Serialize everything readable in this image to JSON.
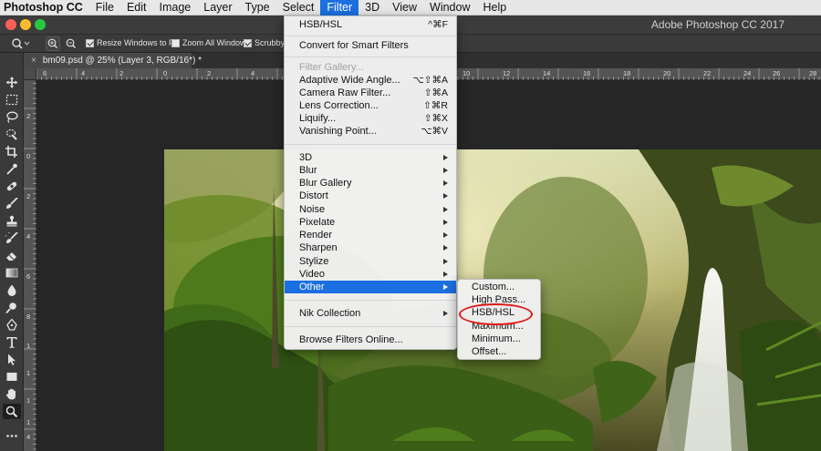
{
  "menubar": {
    "app_name": "Photoshop CC",
    "items": [
      "File",
      "Edit",
      "Image",
      "Layer",
      "Type",
      "Select",
      "Filter",
      "3D",
      "View",
      "Window",
      "Help"
    ],
    "active": "Filter"
  },
  "window": {
    "title": "Adobe Photoshop CC 2017"
  },
  "options_bar": {
    "resize_windows_label": "Resize Windows to Fit",
    "resize_windows_checked": true,
    "zoom_all_label": "Zoom All Windows",
    "zoom_all_checked": false,
    "scrubby_label": "Scrubby",
    "scrubby_checked": true
  },
  "document_tab": {
    "close_glyph": "×",
    "title": "bm09.psd @ 25% (Layer 3, RGB/16*) *"
  },
  "rulers": {
    "horizontal": [
      "6",
      "4",
      "2",
      "0",
      "2",
      "4",
      "6",
      "8",
      "10",
      "12",
      "14",
      "16",
      "18",
      "20",
      "22",
      "24",
      "26",
      "28"
    ],
    "vertical": [
      "2",
      "0",
      "2",
      "4",
      "6",
      "8",
      "1",
      "1",
      "1",
      "1",
      "4"
    ]
  },
  "filter_menu": {
    "last_filter": {
      "label": "HSB/HSL",
      "shortcut": "^⌘F"
    },
    "convert_smart": "Convert for Smart Filters",
    "filter_gallery": "Filter Gallery...",
    "adaptive_wide_angle": {
      "label": "Adaptive Wide Angle...",
      "shortcut": "⌥⇧⌘A"
    },
    "camera_raw": {
      "label": "Camera Raw Filter...",
      "shortcut": "⇧⌘A"
    },
    "lens_correction": {
      "label": "Lens Correction...",
      "shortcut": "⇧⌘R"
    },
    "liquify": {
      "label": "Liquify...",
      "shortcut": "⇧⌘X"
    },
    "vanishing_point": {
      "label": "Vanishing Point...",
      "shortcut": "⌥⌘V"
    },
    "submenus": [
      "3D",
      "Blur",
      "Blur Gallery",
      "Distort",
      "Noise",
      "Pixelate",
      "Render",
      "Sharpen",
      "Stylize",
      "Video",
      "Other"
    ],
    "highlighted": "Other",
    "nik_collection": "Nik Collection",
    "browse_online": "Browse Filters Online..."
  },
  "other_submenu": {
    "items": [
      "Custom...",
      "High Pass...",
      "HSB/HSL",
      "Maximum...",
      "Minimum...",
      "Offset..."
    ],
    "annotated": "HSB/HSL"
  },
  "colors": {
    "menu_highlight": "#1b6fe0",
    "annotation": "#e01818",
    "traffic_close": "#fc5f57",
    "traffic_min": "#fdbc2e",
    "traffic_max": "#28c840"
  },
  "icons": [
    "zoom-tool-icon",
    "move-icon",
    "marquee-icon",
    "lasso-icon",
    "quick-select-icon",
    "crop-icon",
    "eyedropper-icon",
    "healing-brush-icon",
    "brush-icon",
    "clone-stamp-icon",
    "history-brush-icon",
    "eraser-icon",
    "gradient-icon",
    "blur-icon",
    "dodge-icon",
    "pen-icon",
    "type-icon",
    "path-select-icon",
    "rectangle-icon",
    "hand-icon",
    "zoom-icon",
    "more-icon"
  ]
}
